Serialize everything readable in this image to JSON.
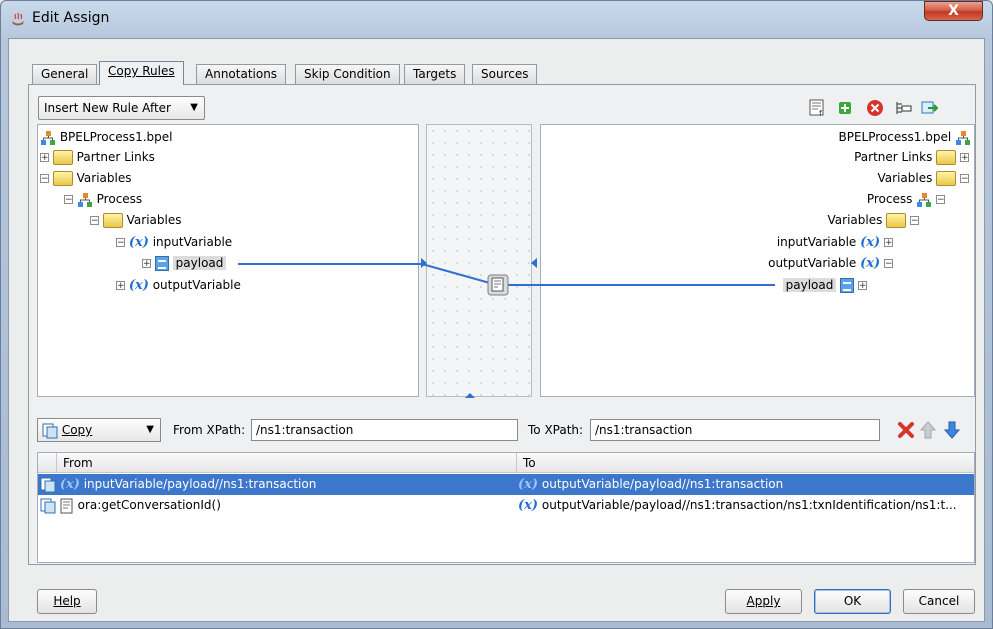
{
  "window": {
    "title": "Edit Assign",
    "close_label": "X"
  },
  "tabs": [
    {
      "label": "General"
    },
    {
      "label": "Copy Rules"
    },
    {
      "label": "Annotations"
    },
    {
      "label": "Skip Condition"
    },
    {
      "label": "Targets"
    },
    {
      "label": "Sources"
    }
  ],
  "active_tab": "Copy Rules",
  "toolbar": {
    "insert_mode": "Insert New Rule After",
    "icons": [
      "expression-icon",
      "add-rule-icon",
      "delete-rule-icon",
      "xml-fragment-icon",
      "literal-icon"
    ]
  },
  "source_tree": {
    "root": "BPELProcess1.bpel",
    "partner_links": "Partner Links",
    "variables": "Variables",
    "process": "Process",
    "process_variables": "Variables",
    "input_variable": "inputVariable",
    "payload": "payload",
    "output_variable": "outputVariable"
  },
  "target_tree": {
    "root": "BPELProcess1.bpel",
    "partner_links": "Partner Links",
    "variables": "Variables",
    "process": "Process",
    "process_variables": "Variables",
    "input_variable": "inputVariable",
    "output_variable": "outputVariable",
    "payload": "payload"
  },
  "xpath": {
    "copy_mode": "Copy",
    "from_label": "From XPath:",
    "from_value": "/ns1:transaction",
    "to_label": "To XPath:",
    "to_value": "/ns1:transaction"
  },
  "rules": {
    "headers": {
      "from": "From",
      "to": "To"
    },
    "rows": [
      {
        "from": "inputVariable/payload//ns1:transaction",
        "to": "outputVariable/payload//ns1:transaction",
        "selected": true
      },
      {
        "from": "ora:getConversationId()",
        "to": "outputVariable/payload//ns1:transaction/ns1:txnIdentification/ns1:t...",
        "selected": false
      }
    ]
  },
  "buttons": {
    "help": "Help",
    "apply": "Apply",
    "ok": "OK",
    "cancel": "Cancel"
  },
  "colors": {
    "selection": "#3d77cc",
    "mapping_line": "#2e6fd0",
    "variable_x": "#1f6fd1"
  }
}
